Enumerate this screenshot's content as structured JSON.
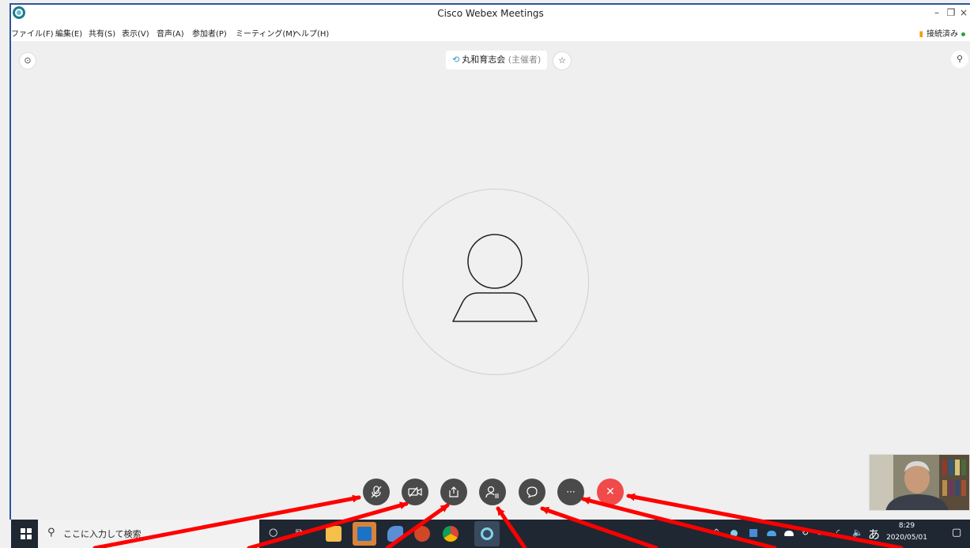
{
  "window": {
    "title": "Cisco Webex Meetings",
    "minimize_glyph": "–",
    "restore_glyph": "❐",
    "close_glyph": "×"
  },
  "menu": {
    "items": [
      {
        "label": "ファイル(F)"
      },
      {
        "label": "編集(E)"
      },
      {
        "label": "共有(S)"
      },
      {
        "label": "表示(V)"
      },
      {
        "label": "音声(A)"
      },
      {
        "label": "参加者(P)"
      },
      {
        "label": "ミーティング(M)"
      },
      {
        "label": "ヘルプ(H)"
      }
    ],
    "connection_status": "接続済み"
  },
  "meeting": {
    "host_name": "丸和育志会",
    "host_role": "(主催者)"
  },
  "controls": [
    {
      "icon": "mute-microphone-icon"
    },
    {
      "icon": "stop-video-icon"
    },
    {
      "icon": "share-content-icon"
    },
    {
      "icon": "participants-icon"
    },
    {
      "icon": "chat-icon"
    },
    {
      "icon": "more-options-icon",
      "glyph": "···"
    },
    {
      "icon": "end-meeting-icon",
      "glyph": "✕"
    }
  ],
  "taskbar": {
    "search_placeholder": "ここに入力して検索",
    "ime_indicator": "あ",
    "time": "8:29",
    "date": "2020/05/01"
  },
  "colors": {
    "end_button": "#f04a4a",
    "control_button": "#4a4a4a",
    "annotation_arrow": "#ff0000",
    "connected_dot": "#2ea043"
  }
}
